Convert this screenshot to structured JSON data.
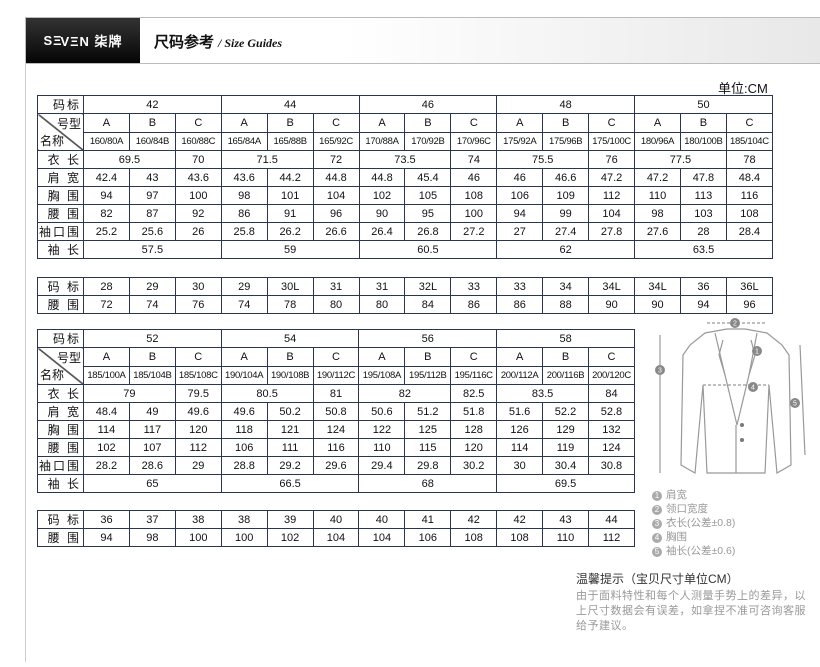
{
  "header": {
    "logo": "SEVEN柒牌",
    "title": "尺码参考",
    "subtitle": "/ Size Guides"
  },
  "unit": "单位:CM",
  "labels": {
    "size": "码标",
    "type": "号型",
    "name": "名称",
    "rows": [
      "衣  长",
      "肩  宽",
      "胸  围",
      "腰  围",
      "袖口围",
      "袖  长"
    ],
    "waist_code": "码  标",
    "waist": "腰  围"
  },
  "tables": [
    {
      "sizes": [
        "42",
        "44",
        "46",
        "48",
        "50"
      ],
      "types": [
        "A",
        "B",
        "C",
        "A",
        "B",
        "C",
        "A",
        "B",
        "C",
        "A",
        "B",
        "C",
        "A",
        "B",
        "C"
      ],
      "names": [
        "160/80A",
        "160/84B",
        "160/88C",
        "165/84A",
        "165/88B",
        "165/92C",
        "170/88A",
        "170/92B",
        "170/96C",
        "175/92A",
        "175/96B",
        "175/100C",
        "180/96A",
        "180/100B",
        "185/104C"
      ],
      "length": [
        [
          "69.5",
          "70"
        ],
        [
          "71.5",
          "72"
        ],
        [
          "73.5",
          "74"
        ],
        [
          "75.5",
          "76"
        ],
        [
          "77.5",
          "78"
        ]
      ],
      "shoulder": [
        "42.4",
        "43",
        "43.6",
        "43.6",
        "44.2",
        "44.8",
        "44.8",
        "45.4",
        "46",
        "46",
        "46.6",
        "47.2",
        "47.2",
        "47.8",
        "48.4"
      ],
      "chest": [
        "94",
        "97",
        "100",
        "98",
        "101",
        "104",
        "102",
        "105",
        "108",
        "106",
        "109",
        "112",
        "110",
        "113",
        "116"
      ],
      "waist": [
        "82",
        "87",
        "92",
        "86",
        "91",
        "96",
        "90",
        "95",
        "100",
        "94",
        "99",
        "104",
        "98",
        "103",
        "108"
      ],
      "cuff": [
        "25.2",
        "25.6",
        "26",
        "25.8",
        "26.2",
        "26.6",
        "26.4",
        "26.8",
        "27.2",
        "27",
        "27.4",
        "27.8",
        "27.6",
        "28",
        "28.4"
      ],
      "sleeve": [
        "57.5",
        "59",
        "60.5",
        "62",
        "63.5"
      ],
      "trouser_code": [
        "28",
        "29",
        "30",
        "29",
        "30L",
        "31",
        "31",
        "32L",
        "33",
        "33",
        "34",
        "34L",
        "34L",
        "36",
        "36L"
      ],
      "trouser_waist": [
        "72",
        "74",
        "76",
        "74",
        "78",
        "80",
        "80",
        "84",
        "86",
        "86",
        "88",
        "90",
        "90",
        "94",
        "96"
      ]
    },
    {
      "sizes": [
        "52",
        "54",
        "56",
        "58"
      ],
      "types": [
        "A",
        "B",
        "C",
        "A",
        "B",
        "C",
        "A",
        "B",
        "C",
        "A",
        "B",
        "C"
      ],
      "names": [
        "185/100A",
        "185/104B",
        "185/108C",
        "190/104A",
        "190/108B",
        "190/112C",
        "195/108A",
        "195/112B",
        "195/116C",
        "200/112A",
        "200/116B",
        "200/120C"
      ],
      "length": [
        [
          "79",
          "79.5"
        ],
        [
          "80.5",
          "81"
        ],
        [
          "82",
          "82.5"
        ],
        [
          "83.5",
          "84"
        ]
      ],
      "shoulder": [
        "48.4",
        "49",
        "49.6",
        "49.6",
        "50.2",
        "50.8",
        "50.6",
        "51.2",
        "51.8",
        "51.6",
        "52.2",
        "52.8"
      ],
      "chest": [
        "114",
        "117",
        "120",
        "118",
        "121",
        "124",
        "122",
        "125",
        "128",
        "126",
        "129",
        "132"
      ],
      "waist": [
        "102",
        "107",
        "112",
        "106",
        "111",
        "116",
        "110",
        "115",
        "120",
        "114",
        "119",
        "124"
      ],
      "cuff": [
        "28.2",
        "28.6",
        "29",
        "28.8",
        "29.2",
        "29.6",
        "29.4",
        "29.8",
        "30.2",
        "30",
        "30.4",
        "30.8"
      ],
      "sleeve": [
        "65",
        "66.5",
        "68",
        "69.5"
      ],
      "trouser_code": [
        "36",
        "37",
        "38",
        "38",
        "39",
        "40",
        "40",
        "41",
        "42",
        "42",
        "43",
        "44"
      ],
      "trouser_waist": [
        "94",
        "98",
        "100",
        "100",
        "102",
        "104",
        "104",
        "106",
        "108",
        "108",
        "110",
        "112"
      ]
    }
  ],
  "legend": [
    "肩宽",
    "领口宽度",
    "衣长(公差±0.8)",
    "胸围",
    "袖长(公差±0.6)"
  ],
  "tips": {
    "title": "温馨提示（宝贝尺寸单位CM）",
    "text": "由于面料特性和每个人测量手势上的差异，以上尺寸数据会有误差，如拿捏不准可咨询客服给予建议。"
  }
}
